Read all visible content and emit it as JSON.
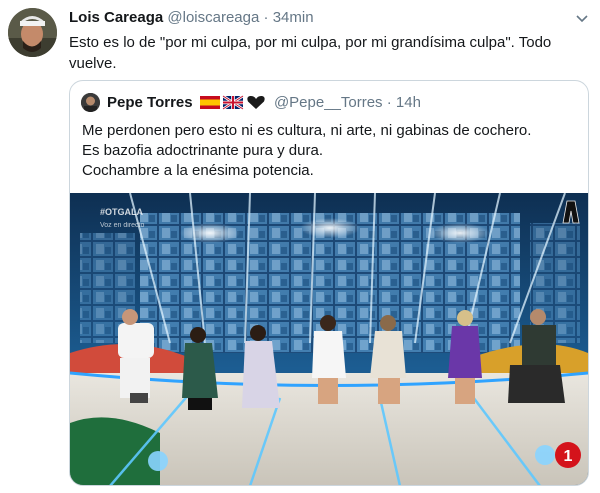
{
  "tweet": {
    "author_name": "Lois Careaga",
    "handle": "@loiscareaga",
    "separator": "·",
    "time": "34min",
    "text": "Esto es lo de \"por mi culpa, por mi culpa, por mi grandísima culpa\". Todo vuelve.",
    "menu_icon": "chevron-down-icon"
  },
  "quoted": {
    "author_name": "Pepe Torres",
    "badges": [
      "spain-flag",
      "uk-flag",
      "black-heart"
    ],
    "handle": "@Pepe__Torres",
    "separator": "·",
    "time": "14h",
    "lines": [
      "Me perdonen pero esto ni es cultura, ni arte, ni gabinas de cochero.",
      "Es bazofia adoctrinante pura y dura.",
      "Cochambre a la enésima potencia."
    ],
    "media": {
      "overlay_top_left": "#OTGALA",
      "overlay_sub": "Voz en directo",
      "channel_logo": "1"
    }
  },
  "colors": {
    "text": "#14171a",
    "secondary": "#657786",
    "border": "#ccd6dd",
    "stage_blue": "#2a6ea8",
    "channel_red": "#d4131b"
  }
}
